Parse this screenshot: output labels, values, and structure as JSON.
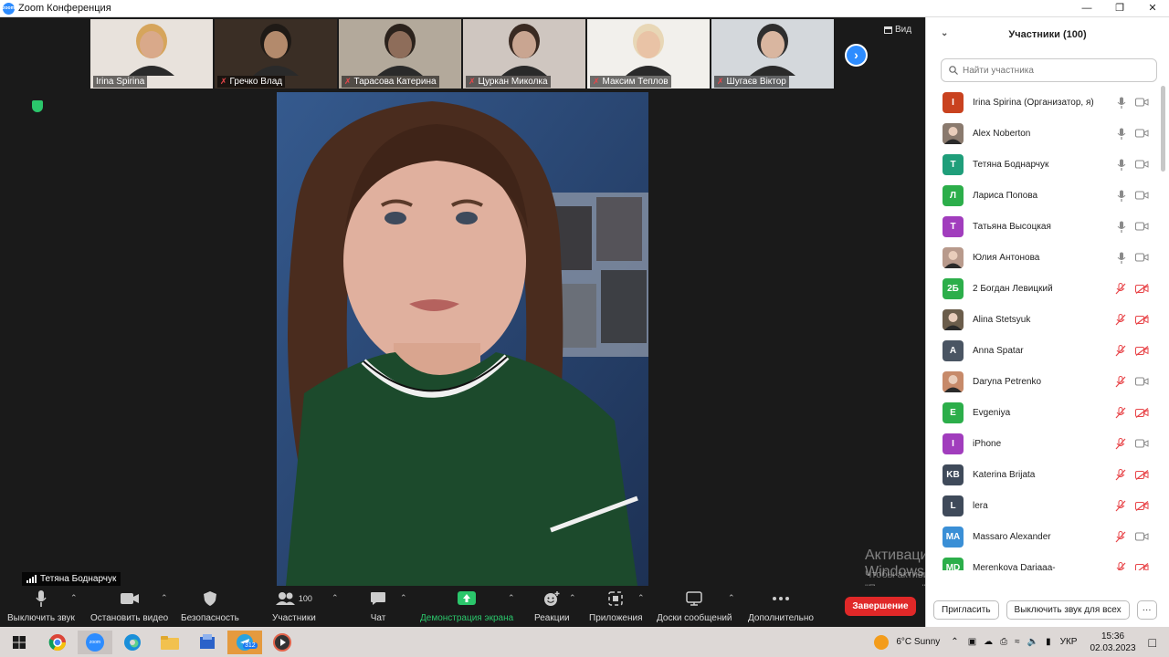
{
  "window": {
    "title": "Zoom Конференция"
  },
  "view_button": {
    "label": "Вид"
  },
  "thumbnails": [
    {
      "name": "Irina Spirina",
      "muted": false,
      "bg": "#e8e2dc",
      "face": "#d9a98a",
      "hair": "#d6a55c"
    },
    {
      "name": "Гречко Влад",
      "muted": true,
      "bg": "#3a2e25",
      "face": "#b38a6c",
      "hair": "#1f1a16"
    },
    {
      "name": "Тарасова Катерина",
      "muted": true,
      "bg": "#b3a99b",
      "face": "#8e6d5a",
      "hair": "#2b221c"
    },
    {
      "name": "Цуркан Миколка",
      "muted": true,
      "bg": "#cfc6c0",
      "face": "#c9a591",
      "hair": "#3a2a22"
    },
    {
      "name": "Максим Теплов",
      "muted": true,
      "bg": "#f2f0ec",
      "face": "#e9c3a6",
      "hair": "#e8d7b6"
    },
    {
      "name": "Шугаєв Віктор",
      "muted": true,
      "bg": "#d4d8dc",
      "face": "#d9b6a0",
      "hair": "#2e2e2e"
    }
  ],
  "active_speaker": {
    "name": "Тетяна Боднарчук"
  },
  "toolbar": {
    "mute": "Выключить звук",
    "video": "Остановить видео",
    "security": "Безопасность",
    "participants": "Участники",
    "participants_count": "100",
    "chat": "Чат",
    "share": "Демонстрация экрана",
    "reactions": "Реакции",
    "apps": "Приложения",
    "whiteboards": "Доски сообщений",
    "more": "Дополнительно",
    "end": "Завершение"
  },
  "panel": {
    "title": "Участники (100)",
    "search_placeholder": "Найти участника",
    "invite": "Пригласить",
    "mute_all": "Выключить звук для всех",
    "more": "···"
  },
  "participants": [
    {
      "name": "Irina Spirina (Организатор, я)",
      "initials": "I",
      "color": "#c9421f",
      "photo": false,
      "muted": false,
      "video_off": false
    },
    {
      "name": "Alex Noberton",
      "initials": "",
      "color": "#8a7a6e",
      "photo": true,
      "muted": false,
      "video_off": false
    },
    {
      "name": "Тетяна Боднарчук",
      "initials": "Т",
      "color": "#1f9e7a",
      "photo": false,
      "muted": false,
      "video_off": false
    },
    {
      "name": "Лариса Попова",
      "initials": "Л",
      "color": "#2cae4a",
      "photo": false,
      "muted": false,
      "video_off": false
    },
    {
      "name": "Татьяна Высоцкая",
      "initials": "Т",
      "color": "#a13dbd",
      "photo": false,
      "muted": false,
      "video_off": false
    },
    {
      "name": "Юлия Антонова",
      "initials": "",
      "color": "#b89a8c",
      "photo": true,
      "muted": false,
      "video_off": false
    },
    {
      "name": "2 Богдан Левицкий",
      "initials": "2Б",
      "color": "#2cae4a",
      "photo": false,
      "muted": true,
      "video_off": true
    },
    {
      "name": "Alina Stetsyuk",
      "initials": "",
      "color": "#6b5d4b",
      "photo": true,
      "muted": true,
      "video_off": true
    },
    {
      "name": "Anna Spatar",
      "initials": "A",
      "color": "#4a5563",
      "photo": false,
      "muted": true,
      "video_off": true
    },
    {
      "name": "Daryna Petrenko",
      "initials": "",
      "color": "#c78a6a",
      "photo": true,
      "muted": true,
      "video_off": false
    },
    {
      "name": "Evgeniya",
      "initials": "E",
      "color": "#2cae4a",
      "photo": false,
      "muted": true,
      "video_off": true
    },
    {
      "name": "iPhone",
      "initials": "I",
      "color": "#a13dbd",
      "photo": false,
      "muted": true,
      "video_off": false
    },
    {
      "name": "Katerina Brijata",
      "initials": "KB",
      "color": "#3f4a5a",
      "photo": false,
      "muted": true,
      "video_off": true
    },
    {
      "name": "lera",
      "initials": "L",
      "color": "#3f4a5a",
      "photo": false,
      "muted": true,
      "video_off": true
    },
    {
      "name": "Massaro Alexander",
      "initials": "MA",
      "color": "#3a8fd6",
      "photo": false,
      "muted": true,
      "video_off": false
    },
    {
      "name": "Merenkova Dariaaa-",
      "initials": "MD",
      "color": "#2cae4a",
      "photo": false,
      "muted": true,
      "video_off": true
    }
  ],
  "watermark": {
    "line1": "Активация Windows",
    "line2": "Чтобы активировать Windows, перейдите в раздел",
    "line3": "\"Параметры\"."
  },
  "taskbar": {
    "weather": "6°C  Sunny",
    "language": "УКР",
    "time": "15:36",
    "date": "02.03.2023",
    "badge": "312"
  }
}
